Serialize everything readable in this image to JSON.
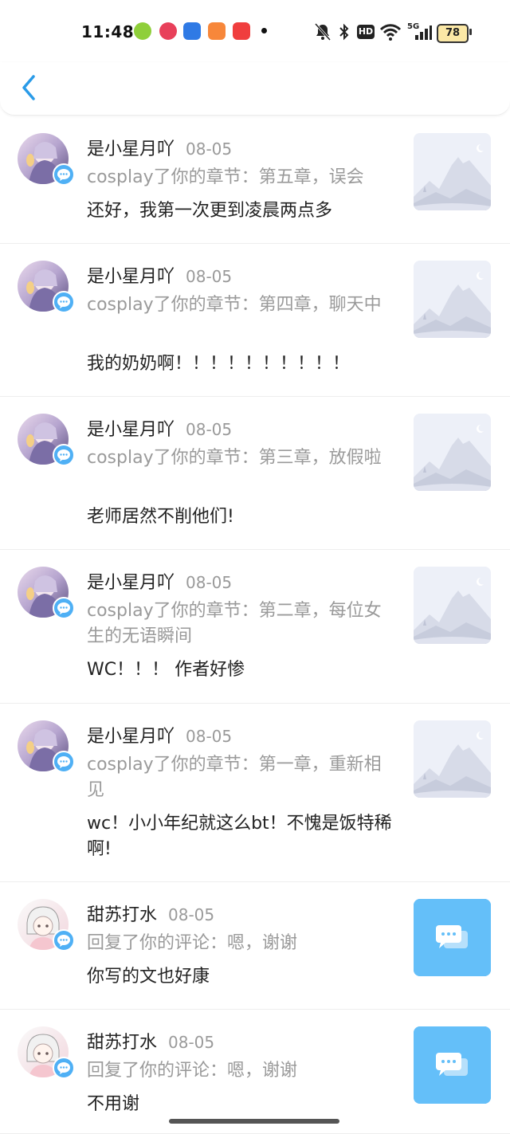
{
  "status": {
    "time": "11:48",
    "battery": "78",
    "network": "5G",
    "hd": "HD"
  },
  "items": [
    {
      "name": "是小星月吖",
      "date": "08-05",
      "action": "cosplay了你的章节：第五章，误会",
      "comment": "还好，我第一次更到凌晨两点多"
    },
    {
      "name": "是小星月吖",
      "date": "08-05",
      "action": "cosplay了你的章节：第四章，聊天中",
      "comment": "我的奶奶啊！！！！！！！！！！"
    },
    {
      "name": "是小星月吖",
      "date": "08-05",
      "action": "cosplay了你的章节：第三章，放假啦",
      "comment": "老师居然不削他们!"
    },
    {
      "name": "是小星月吖",
      "date": "08-05",
      "action": "cosplay了你的章节：第二章，每位女生的无语瞬间",
      "comment": "WC！！！ 作者好惨"
    },
    {
      "name": "是小星月吖",
      "date": "08-05",
      "action": "cosplay了你的章节：第一章，重新相见",
      "comment": "wc！小小年纪就这么bt！不愧是饭特稀啊!"
    },
    {
      "name": "甜苏打水",
      "date": "08-05",
      "action": "回复了你的评论：嗯，谢谢",
      "comment": "你写的文也好康"
    },
    {
      "name": "甜苏打水",
      "date": "08-05",
      "action": "回复了你的评论：嗯，谢谢",
      "comment": "不用谢"
    }
  ]
}
